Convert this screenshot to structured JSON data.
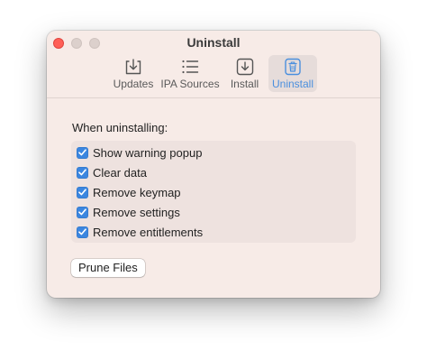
{
  "window": {
    "title": "Uninstall"
  },
  "toolbar": {
    "items": [
      {
        "label": "Updates",
        "icon": "download-tray-icon",
        "selected": false
      },
      {
        "label": "IPA Sources",
        "icon": "list-icon",
        "selected": false
      },
      {
        "label": "Install",
        "icon": "install-box-icon",
        "selected": false
      },
      {
        "label": "Uninstall",
        "icon": "trash-icon",
        "selected": true
      }
    ],
    "selected_color": "#4a8fde"
  },
  "uninstall": {
    "section_label": "When uninstalling:",
    "options": [
      {
        "label": "Show warning popup",
        "checked": true
      },
      {
        "label": "Clear data",
        "checked": true
      },
      {
        "label": "Remove keymap",
        "checked": true
      },
      {
        "label": "Remove settings",
        "checked": true
      },
      {
        "label": "Remove entitlements",
        "checked": true
      }
    ],
    "prune_button_label": "Prune Files"
  },
  "colors": {
    "window_bg": "#f7ebe7",
    "checkbox_accent": "#3b86e0",
    "close_button": "#ff5f57"
  }
}
